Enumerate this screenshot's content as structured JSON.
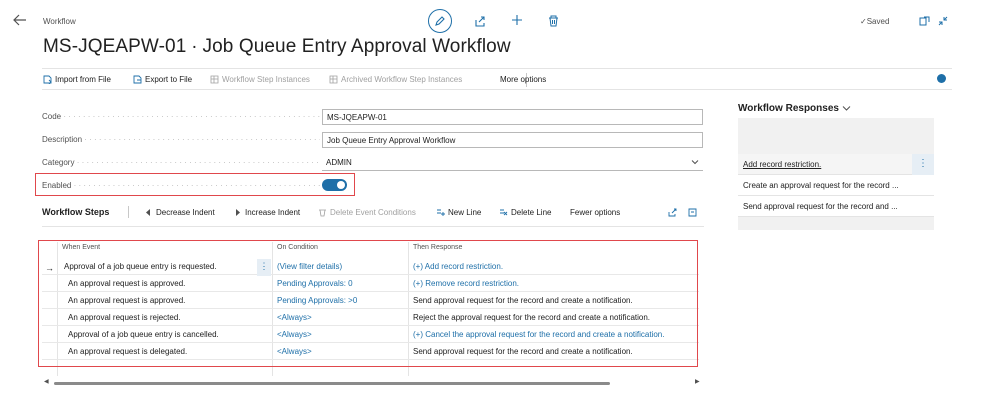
{
  "header": {
    "breadcrumb": "Workflow",
    "title": "MS-JQEAPW-01 ∙ Job Queue Entry Approval Workflow",
    "saved_label": "✓Saved"
  },
  "actions": {
    "import": "Import from File",
    "export": "Export to File",
    "step_instances": "Workflow Step Instances",
    "archived": "Archived Workflow Step Instances",
    "more": "More options"
  },
  "fields": {
    "code_label": "Code",
    "code_value": "MS-JQEAPW-01",
    "description_label": "Description",
    "description_value": "Job Queue Entry Approval Workflow",
    "category_label": "Category",
    "category_value": "ADMIN",
    "enabled_label": "Enabled",
    "enabled": true
  },
  "steps": {
    "title": "Workflow Steps",
    "decrease_indent": "Decrease Indent",
    "increase_indent": "Increase Indent",
    "delete_event_conditions": "Delete Event Conditions",
    "new_line": "New Line",
    "delete_line": "Delete Line",
    "fewer_options": "Fewer options",
    "columns": [
      "When Event",
      "On Condition",
      "Then Response"
    ],
    "rows": [
      {
        "event": "Approval of a job queue entry is requested.",
        "condition": "(View filter details)",
        "response": "(+) Add record restriction."
      },
      {
        "event": "An approval request is approved.",
        "condition": "Pending Approvals: 0",
        "response": "(+) Remove record restriction."
      },
      {
        "event": "An approval request is approved.",
        "condition": "Pending Approvals: >0",
        "response": "Send approval request for the record and create a notification."
      },
      {
        "event": "An approval request is rejected.",
        "condition": "<Always>",
        "response": "Reject the approval request for the record and create a notification."
      },
      {
        "event": "Approval of a job queue entry is cancelled.",
        "condition": "<Always>",
        "response": "(+) Cancel the approval request for the record and create a notification."
      },
      {
        "event": "An approval request is delegated.",
        "condition": "<Always>",
        "response": "Send approval request for the record and create a notification."
      }
    ]
  },
  "responses": {
    "title": "Workflow Responses",
    "items": [
      "Add record restriction.",
      "Create an approval request for the record ...",
      "Send approval request for the record and ..."
    ]
  },
  "colors": {
    "accent": "#1e6fa8",
    "highlight_border": "#e0484c"
  }
}
